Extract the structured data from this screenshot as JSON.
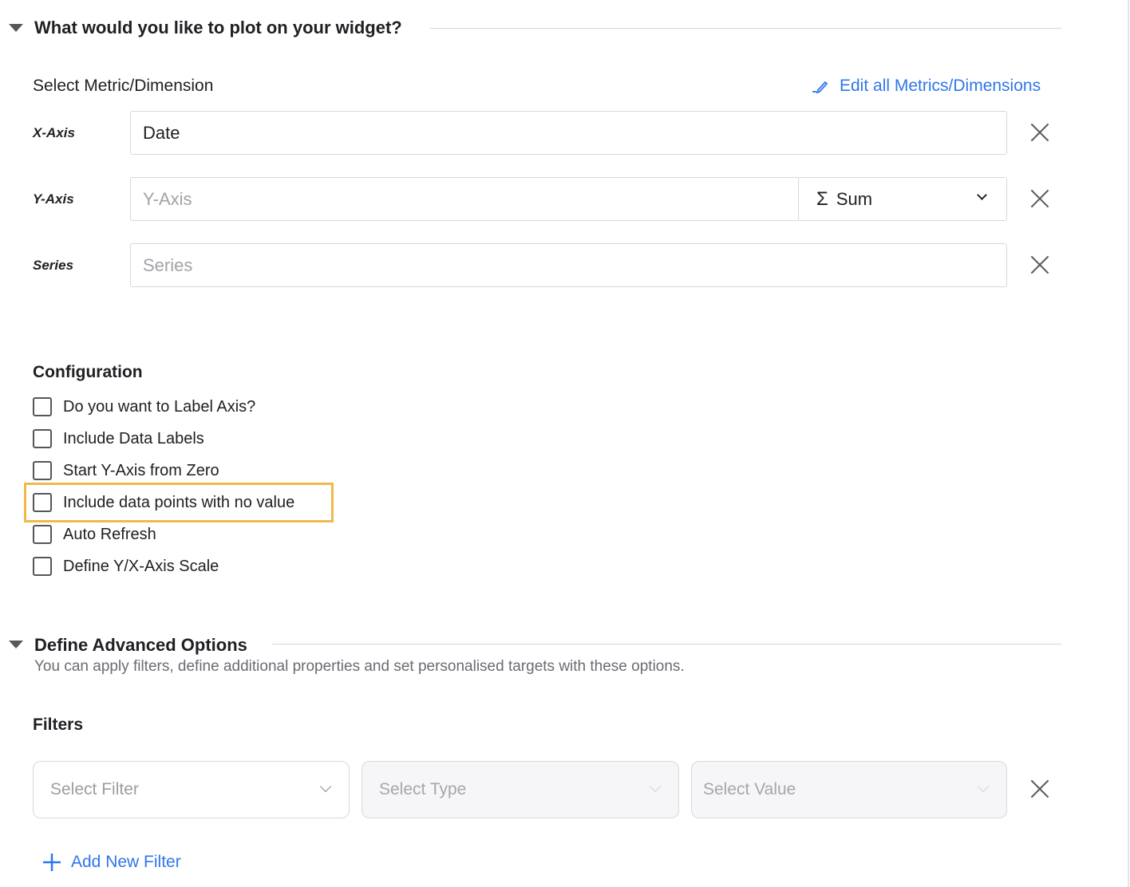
{
  "section1": {
    "title": "What would you like to plot on your widget?",
    "select_label": "Select Metric/Dimension",
    "edit_link": "Edit all Metrics/Dimensions",
    "x_axis": {
      "label": "X-Axis",
      "value": "Date"
    },
    "y_axis": {
      "label": "Y-Axis",
      "placeholder": "Y-Axis",
      "aggregation": "Sum",
      "aggregation_icon": "Σ"
    },
    "series": {
      "label": "Series",
      "placeholder": "Series"
    }
  },
  "configuration": {
    "title": "Configuration",
    "options": [
      {
        "label": "Do you want to Label Axis?",
        "checked": false
      },
      {
        "label": "Include Data Labels",
        "checked": false
      },
      {
        "label": "Start Y-Axis from Zero",
        "checked": false
      },
      {
        "label": "Include data points with no value",
        "checked": false,
        "highlighted": true
      },
      {
        "label": "Auto Refresh",
        "checked": false
      },
      {
        "label": "Define Y/X-Axis Scale",
        "checked": false
      }
    ]
  },
  "advanced": {
    "title": "Define Advanced Options",
    "description": "You can apply filters, define additional properties and set personalised targets with these options."
  },
  "filters": {
    "title": "Filters",
    "filter_placeholder": "Select Filter",
    "type_placeholder": "Select Type",
    "value_placeholder": "Select Value",
    "add_label": "Add New Filter"
  },
  "colors": {
    "accent": "#2f76ea",
    "highlight": "#f0b94a"
  }
}
